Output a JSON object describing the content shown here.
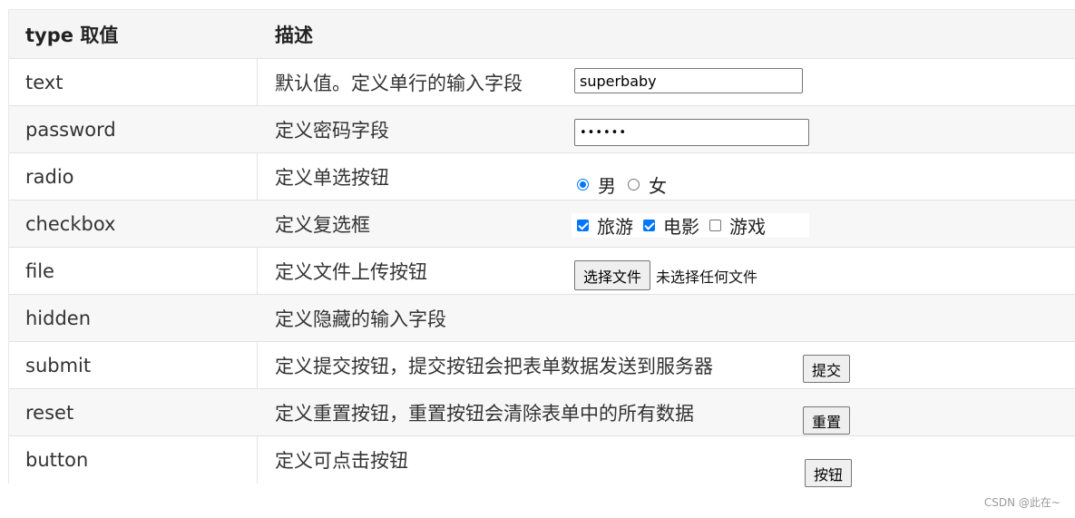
{
  "header": {
    "col1": "type 取值",
    "col2": "描述"
  },
  "rows": [
    {
      "type": "text",
      "desc": "默认值。定义单行的输入字段"
    },
    {
      "type": "password",
      "desc": "定义密码字段"
    },
    {
      "type": "radio",
      "desc": "定义单选按钮"
    },
    {
      "type": "checkbox",
      "desc": "定义复选框"
    },
    {
      "type": "file",
      "desc": "定义文件上传按钮"
    },
    {
      "type": "hidden",
      "desc": "定义隐藏的输入字段"
    },
    {
      "type": "submit",
      "desc": "定义提交按钮，提交按钮会把表单数据发送到服务器"
    },
    {
      "type": "reset",
      "desc": "定义重置按钮，重置按钮会清除表单中的所有数据"
    },
    {
      "type": "button",
      "desc": "定义可点击按钮"
    }
  ],
  "controls": {
    "text_value": "superbaby",
    "password_value": "••••••",
    "radio": {
      "option1": "男",
      "option2": "女",
      "selected": "男"
    },
    "checkbox": {
      "option1": "旅游",
      "option2": "电影",
      "option3": "游戏",
      "checked": [
        "旅游",
        "电影"
      ]
    },
    "file": {
      "button_label": "选择文件",
      "status": "未选择任何文件"
    },
    "submit_label": "提交",
    "reset_label": "重置",
    "button_label": "按钮"
  },
  "credit": "CSDN @此在~"
}
